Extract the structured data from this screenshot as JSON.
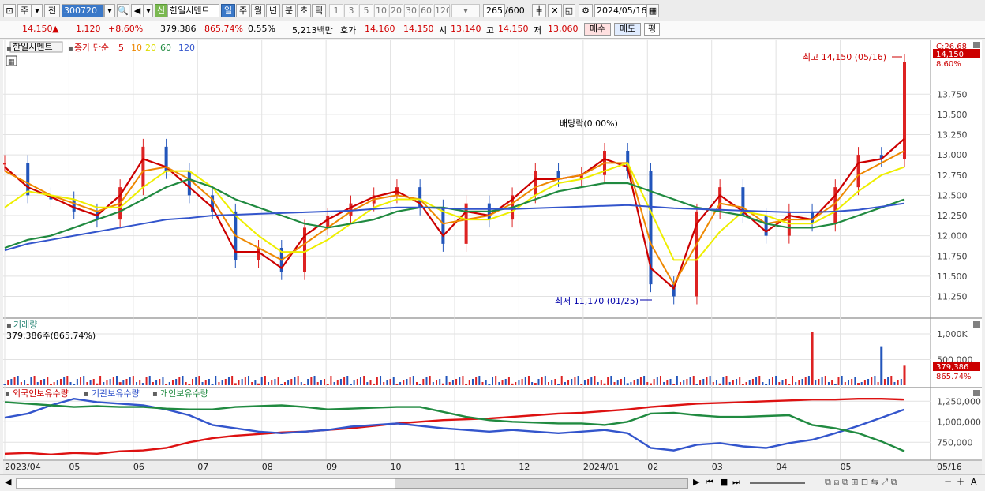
{
  "toolbar": {
    "period_btn": "주",
    "prev_btn": "전",
    "code": "300720",
    "tag_new": "신",
    "stock_name": "한일시멘트",
    "periods": [
      "일",
      "주",
      "월",
      "년",
      "분",
      "초",
      "틱"
    ],
    "intervals": [
      "1",
      "3",
      "5",
      "10",
      "20",
      "30",
      "60",
      "120"
    ],
    "count_value": "265",
    "count_total": "/600",
    "date": "2024/05/16"
  },
  "info": {
    "price": "14,150",
    "arrow": "▲",
    "change": "1,120",
    "rate": "+8.60%",
    "volume": "379,386",
    "vol_ratio": "865.74%",
    "turnover": "0.55%",
    "amount": "5,213백만",
    "bid_label": "호가",
    "bid": "14,160",
    "ask": "14,150",
    "open_label": "시",
    "open": "13,140",
    "high_label": "고",
    "high": "14,150",
    "low_label": "저",
    "low": "13,060",
    "buy_btn": "매수",
    "sell_btn": "매도",
    "eval_btn": "평"
  },
  "price_panel": {
    "name_label": "한일시멘트",
    "legend_prefix": "종가 단순",
    "ma_labels": [
      "5",
      "10",
      "20",
      "60",
      "120"
    ],
    "high_annotation": "최고 14,150 (05/16)",
    "low_annotation": "최저 11,170 (01/25)",
    "dividend_annotation": "배당락(0.00%)",
    "top_scale_label": "C:26.68",
    "price_badge": "14,150",
    "rate_badge": "8.60%"
  },
  "volume_panel": {
    "title": "거래량",
    "value_label": "379,386주(865.74%)",
    "badge_value": "379,386",
    "badge_rate": "865.74%"
  },
  "holder_panel": {
    "legend": [
      "외국인보유수량",
      "기관보유수량",
      "개인보유수량"
    ]
  },
  "chart_data": [
    {
      "type": "line",
      "title": "한일시멘트",
      "x": [
        "2023/04",
        "05",
        "06",
        "07",
        "08",
        "09",
        "10",
        "11",
        "12",
        "2024/01",
        "02",
        "03",
        "04",
        "05",
        "05/16"
      ],
      "y_ticks": [
        11250,
        11500,
        11750,
        12000,
        12250,
        12500,
        12750,
        13000,
        13250,
        13500,
        13750
      ],
      "ylim": [
        11050,
        14250
      ],
      "series": [
        {
          "name": "종가",
          "values": [
            12900,
            12500,
            12450,
            12300,
            12200,
            12600,
            13100,
            12800,
            12500,
            12300,
            11700,
            11850,
            11550,
            12100,
            12250,
            12400,
            12500,
            12600,
            12350,
            11900,
            12400,
            12200,
            12500,
            12800,
            12700,
            12750,
            13050,
            12800,
            11400,
            11250,
            12300,
            12600,
            12250,
            12000,
            12300,
            12150,
            12600,
            13000,
            12950,
            14150
          ]
        },
        {
          "name": "5",
          "values": [
            12850,
            12600,
            12480,
            12350,
            12250,
            12500,
            12950,
            12850,
            12600,
            12350,
            11800,
            11800,
            11600,
            12000,
            12200,
            12350,
            12480,
            12550,
            12400,
            12000,
            12300,
            12250,
            12450,
            12700,
            12700,
            12750,
            12950,
            12850,
            11600,
            11350,
            12150,
            12500,
            12300,
            12050,
            12250,
            12200,
            12500,
            12900,
            12950,
            13200
          ]
        },
        {
          "name": "10",
          "values": [
            12800,
            12650,
            12500,
            12400,
            12300,
            12400,
            12800,
            12850,
            12700,
            12450,
            12000,
            11850,
            11700,
            11900,
            12100,
            12300,
            12450,
            12500,
            12450,
            12150,
            12200,
            12250,
            12400,
            12600,
            12700,
            12750,
            12900,
            12900,
            11900,
            11400,
            11900,
            12400,
            12350,
            12150,
            12200,
            12200,
            12400,
            12750,
            12900,
            13050
          ]
        },
        {
          "name": "20",
          "values": [
            12350,
            12550,
            12500,
            12450,
            12350,
            12350,
            12600,
            12800,
            12800,
            12600,
            12250,
            12000,
            11800,
            11800,
            11950,
            12150,
            12350,
            12450,
            12450,
            12300,
            12200,
            12200,
            12300,
            12500,
            12650,
            12700,
            12800,
            12900,
            12300,
            11700,
            11700,
            12050,
            12300,
            12250,
            12150,
            12150,
            12300,
            12550,
            12750,
            12850
          ]
        },
        {
          "name": "60",
          "values": [
            11850,
            11950,
            12000,
            12100,
            12200,
            12300,
            12450,
            12600,
            12700,
            12600,
            12450,
            12350,
            12250,
            12150,
            12100,
            12150,
            12200,
            12300,
            12350,
            12350,
            12300,
            12300,
            12350,
            12450,
            12550,
            12600,
            12650,
            12650,
            12550,
            12450,
            12350,
            12300,
            12250,
            12150,
            12100,
            12100,
            12150,
            12250,
            12350,
            12450
          ]
        },
        {
          "name": "120",
          "values": [
            11820,
            11900,
            11950,
            12000,
            12050,
            12100,
            12150,
            12200,
            12220,
            12250,
            12260,
            12270,
            12280,
            12290,
            12300,
            12310,
            12330,
            12350,
            12350,
            12340,
            12330,
            12330,
            12330,
            12340,
            12350,
            12360,
            12370,
            12380,
            12360,
            12340,
            12330,
            12320,
            12310,
            12300,
            12290,
            12290,
            12300,
            12320,
            12360,
            12400
          ]
        }
      ]
    },
    {
      "type": "bar",
      "title": "거래량",
      "y_ticks": [
        500000,
        1000000
      ],
      "ylim": [
        0,
        1200000
      ],
      "series": [
        {
          "name": "거래량",
          "values": [
            30000,
            25000,
            28000,
            22000,
            35000,
            60000,
            45000,
            30000,
            25000,
            20000,
            40000,
            35000,
            28000,
            30000,
            25000,
            28000,
            32000,
            30000,
            26000,
            35000,
            30000,
            28000,
            33000,
            45000,
            30000,
            28000,
            35000,
            40000,
            38000,
            30000,
            28000,
            35000,
            25000,
            30000,
            28000,
            1040000,
            30000,
            45000,
            760000,
            379386
          ]
        }
      ]
    },
    {
      "type": "line",
      "title": "보유수량",
      "y_ticks": [
        750000,
        1000000,
        1250000
      ],
      "ylim": [
        560000,
        1330000
      ],
      "series": [
        {
          "name": "외국인보유수량",
          "values": [
            610000,
            620000,
            600000,
            620000,
            610000,
            640000,
            650000,
            680000,
            750000,
            800000,
            830000,
            850000,
            870000,
            880000,
            900000,
            920000,
            950000,
            980000,
            1000000,
            1020000,
            1030000,
            1040000,
            1060000,
            1080000,
            1100000,
            1110000,
            1130000,
            1150000,
            1180000,
            1200000,
            1220000,
            1230000,
            1240000,
            1250000,
            1260000,
            1270000,
            1270000,
            1280000,
            1280000,
            1270000
          ]
        },
        {
          "name": "기관보유수량",
          "values": [
            1050000,
            1100000,
            1200000,
            1280000,
            1240000,
            1220000,
            1200000,
            1150000,
            1080000,
            960000,
            920000,
            880000,
            860000,
            880000,
            900000,
            940000,
            960000,
            980000,
            950000,
            920000,
            900000,
            880000,
            900000,
            880000,
            860000,
            880000,
            900000,
            860000,
            680000,
            650000,
            720000,
            740000,
            700000,
            680000,
            740000,
            780000,
            860000,
            950000,
            1050000,
            1150000
          ]
        },
        {
          "name": "개인보유수량",
          "values": [
            1240000,
            1220000,
            1200000,
            1180000,
            1190000,
            1180000,
            1180000,
            1160000,
            1150000,
            1150000,
            1180000,
            1190000,
            1200000,
            1180000,
            1150000,
            1160000,
            1170000,
            1180000,
            1180000,
            1120000,
            1060000,
            1020000,
            1000000,
            990000,
            980000,
            980000,
            960000,
            1000000,
            1100000,
            1110000,
            1080000,
            1060000,
            1060000,
            1070000,
            1080000,
            960000,
            920000,
            860000,
            760000,
            640000
          ]
        }
      ]
    }
  ]
}
